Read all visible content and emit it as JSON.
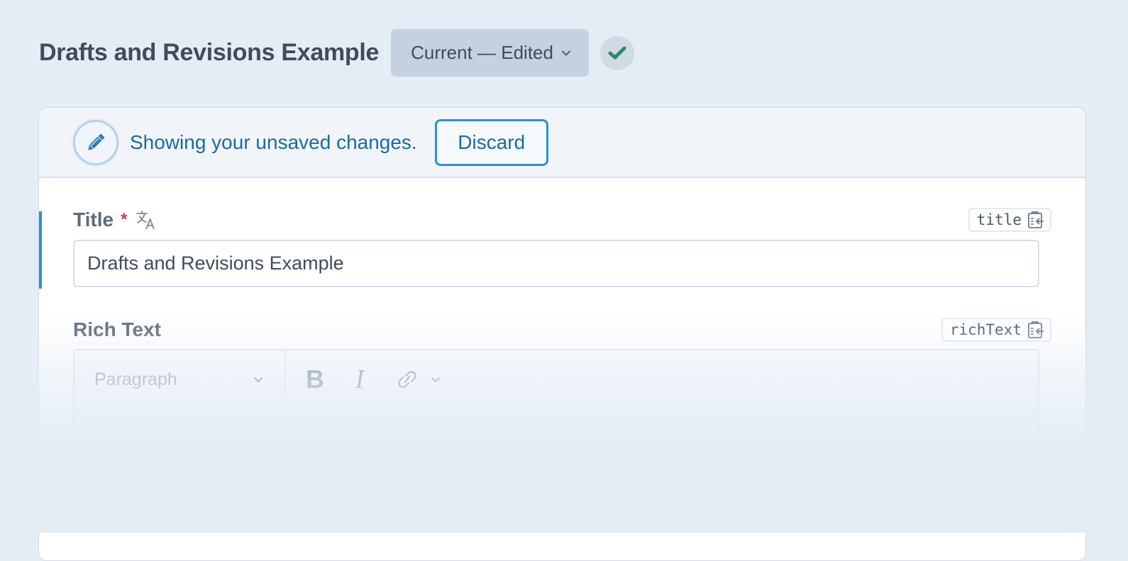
{
  "header": {
    "title": "Drafts and Revisions Example",
    "revision_label": "Current — Edited",
    "status_icon": "checkmark-icon",
    "status_color": "#2f8a6c"
  },
  "banner": {
    "icon": "pencil-icon",
    "message": "Showing your unsaved changes.",
    "discard_label": "Discard",
    "accent_color": "#2792d6"
  },
  "fields": {
    "title": {
      "label": "Title",
      "required_marker": "*",
      "translatable_icon": "translate-icon",
      "handle": "title",
      "value": "Drafts and Revisions Example"
    },
    "rich_text": {
      "label": "Rich Text",
      "handle": "richText",
      "toolbar": {
        "block_format": "Paragraph",
        "bold_label": "B",
        "italic_label": "I",
        "link_icon": "link-icon"
      }
    }
  }
}
